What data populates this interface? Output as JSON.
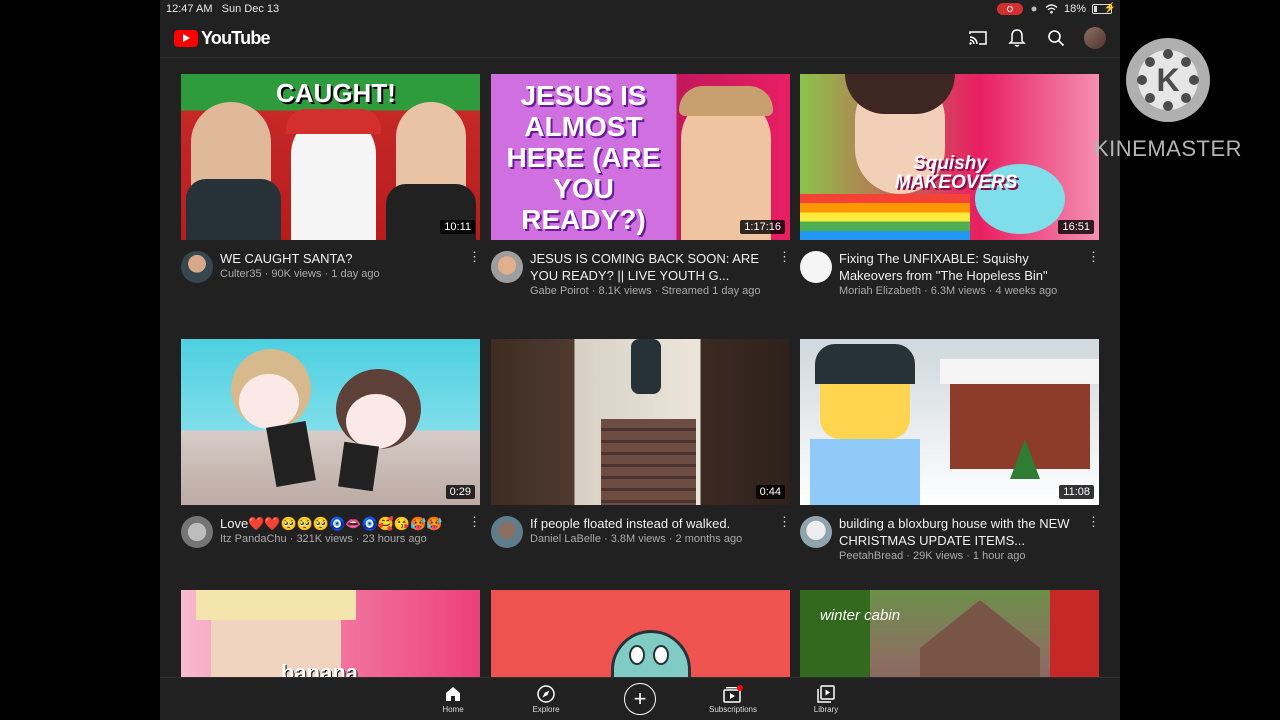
{
  "status_bar": {
    "time": "12:47 AM",
    "date": "Sun Dec 13",
    "battery": "18%",
    "battery_level": 0.18
  },
  "header": {
    "logo_text": "YouTube",
    "icons": [
      "cast-icon",
      "bell-icon",
      "search-icon",
      "account-avatar"
    ]
  },
  "videos": [
    {
      "title": "WE CAUGHT SANTA?",
      "channel": "Culter35",
      "views": "90K views",
      "age": "1 day ago",
      "duration": "10:11",
      "thumb_text": "CAUGHT!"
    },
    {
      "title": "JESUS IS COMING BACK SOON: ARE YOU READY? || LIVE YOUTH G...",
      "channel": "Gabe Poirot",
      "views": "8.1K views",
      "age": "Streamed 1 day ago",
      "duration": "1:17:16",
      "thumb_text": "JESUS IS ALMOST HERE (ARE YOU READY?)"
    },
    {
      "title": "Fixing The UNFIXABLE: Squishy Makeovers from \"The Hopeless Bin\"",
      "channel": "Moriah Elizabeth",
      "views": "6.3M views",
      "age": "4 weeks ago",
      "duration": "16:51",
      "thumb_text": "Squishy MAKEOVERS"
    },
    {
      "title": "Love❤️❤️🥺🥺🥺🧿👄🧿🥰😘🥵🥵",
      "channel": "Itz PandaChu",
      "views": "321K views",
      "age": "23 hours ago",
      "duration": "0:29",
      "thumb_text": ""
    },
    {
      "title": "If people floated instead of walked.",
      "channel": "Daniel LaBelle",
      "views": "3.8M views",
      "age": "2 months ago",
      "duration": "0:44",
      "thumb_text": ""
    },
    {
      "title": "building a bloxburg house with the NEW CHRISTMAS UPDATE ITEMS...",
      "channel": "PeetahBread",
      "views": "29K views",
      "age": "1 hour ago",
      "duration": "11:08",
      "thumb_text": ""
    },
    {
      "title": "",
      "channel": "",
      "views": "",
      "age": "",
      "duration": "",
      "thumb_text": "banana"
    },
    {
      "title": "",
      "channel": "",
      "views": "",
      "age": "",
      "duration": "",
      "thumb_text": ""
    },
    {
      "title": "",
      "channel": "",
      "views": "",
      "age": "",
      "duration": "",
      "thumb_text": "winter cabin"
    }
  ],
  "bottom_nav": [
    {
      "label": "Home",
      "icon": "home-icon",
      "active": true
    },
    {
      "label": "Explore",
      "icon": "compass-icon",
      "active": false
    },
    {
      "label": "",
      "icon": "create-plus-icon",
      "active": false
    },
    {
      "label": "Subscriptions",
      "icon": "subscriptions-icon",
      "active": false
    },
    {
      "label": "Library",
      "icon": "library-icon",
      "active": false
    }
  ],
  "watermark": {
    "brand": "KINEMASTER"
  }
}
